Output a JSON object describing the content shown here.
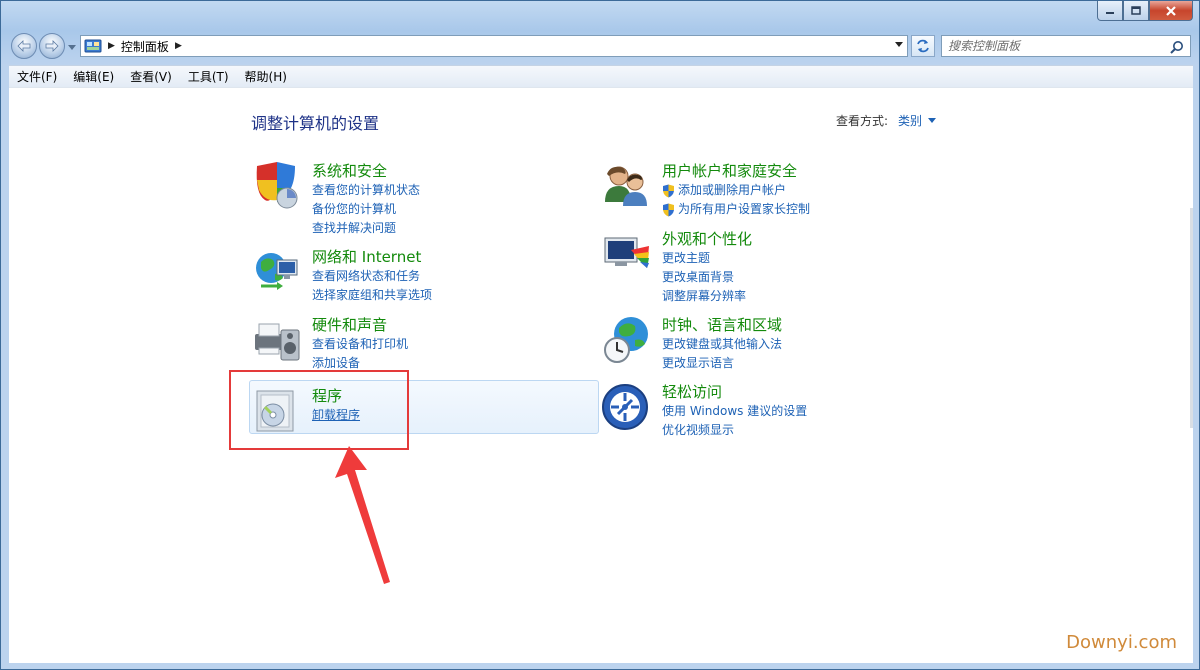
{
  "address": {
    "breadcrumb": "控制面板"
  },
  "search": {
    "placeholder": "搜索控制面板"
  },
  "menu": [
    "文件(F)",
    "编辑(E)",
    "查看(V)",
    "工具(T)",
    "帮助(H)"
  ],
  "page": {
    "title": "调整计算机的设置",
    "viewby_label": "查看方式:",
    "viewby_value": "类别"
  },
  "categories": {
    "system": {
      "title": "系统和安全",
      "links": [
        "查看您的计算机状态",
        "备份您的计算机",
        "查找并解决问题"
      ]
    },
    "network": {
      "title": "网络和 Internet",
      "links": [
        "查看网络状态和任务",
        "选择家庭组和共享选项"
      ]
    },
    "hardware": {
      "title": "硬件和声音",
      "links": [
        "查看设备和打印机",
        "添加设备"
      ]
    },
    "programs": {
      "title": "程序",
      "links": [
        "卸载程序"
      ]
    },
    "users": {
      "title": "用户帐户和家庭安全",
      "links": [
        "添加或删除用户帐户",
        "为所有用户设置家长控制"
      ]
    },
    "appearance": {
      "title": "外观和个性化",
      "links": [
        "更改主题",
        "更改桌面背景",
        "调整屏幕分辨率"
      ]
    },
    "clock": {
      "title": "时钟、语言和区域",
      "links": [
        "更改键盘或其他输入法",
        "更改显示语言"
      ]
    },
    "ease": {
      "title": "轻松访问",
      "links": [
        "使用 Windows 建议的设置",
        "优化视频显示"
      ]
    }
  },
  "watermark": "Downyi.com",
  "colors": {
    "category_title": "#138a0c",
    "link": "#1e62b5",
    "page_title": "#1e3287",
    "annotation_red": "#e43a3a"
  }
}
